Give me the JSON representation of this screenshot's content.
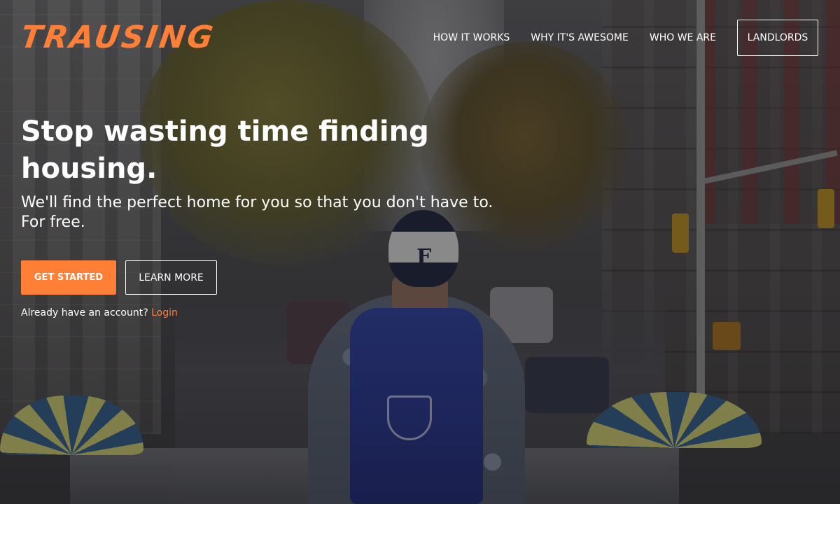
{
  "brand": {
    "logo_text": "TRAUSING",
    "accent_color": "#ff7f37"
  },
  "nav": {
    "links": [
      "HOW IT WORKS",
      "WHY IT'S AWESOME",
      "WHO WE ARE"
    ],
    "landlords_button": "LANDLORDS"
  },
  "hero": {
    "headline": "Stop wasting time finding housing.",
    "subheadline_line1": "We'll find the perfect home for you so that you don't have to.",
    "subheadline_line2": "For free.",
    "primary_button": "GET STARTED",
    "secondary_button": "LEARN MORE",
    "account_prompt": "Already have an account?",
    "login_link": "Login",
    "cap_letter": "F"
  }
}
